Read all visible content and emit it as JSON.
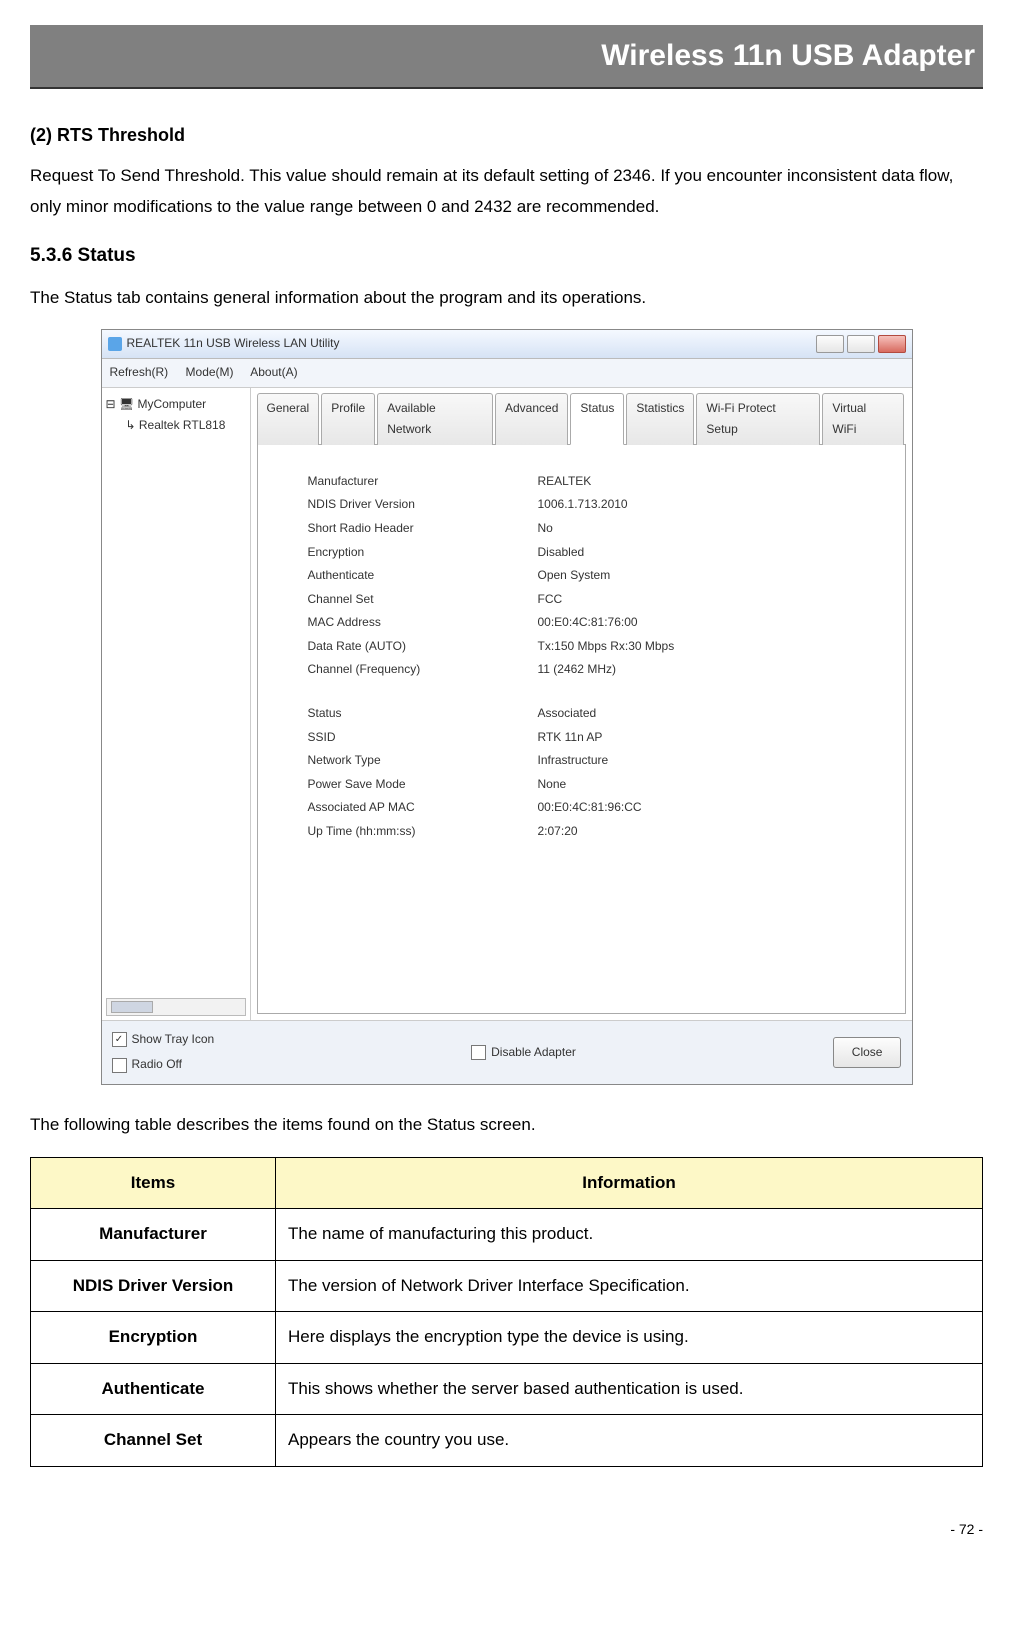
{
  "header": {
    "title": "Wireless 11n USB Adapter"
  },
  "sec_rts": {
    "heading": "(2) RTS Threshold",
    "para": "Request To Send Threshold. This value should remain at its default setting of 2346. If you encounter inconsistent data flow, only minor modifications to the value range between 0 and 2432 are recommended."
  },
  "sec_status": {
    "heading": "5.3.6    Status",
    "para": "The Status tab contains general information about the program and its operations.",
    "table_intro": "The following table describes the items found on the Status screen."
  },
  "win": {
    "title": "REALTEK 11n USB Wireless LAN Utility",
    "menu": [
      "Refresh(R)",
      "Mode(M)",
      "About(A)"
    ],
    "tree": {
      "root": "MyComputer",
      "child": "Realtek RTL818"
    },
    "tabs": [
      "General",
      "Profile",
      "Available Network",
      "Advanced",
      "Status",
      "Statistics",
      "Wi-Fi Protect Setup",
      "Virtual WiFi"
    ],
    "active_tab": "Status",
    "group1": [
      {
        "k": "Manufacturer",
        "v": "REALTEK"
      },
      {
        "k": "NDIS Driver Version",
        "v": "1006.1.713.2010"
      },
      {
        "k": "Short Radio Header",
        "v": "No"
      },
      {
        "k": "Encryption",
        "v": "Disabled"
      },
      {
        "k": "Authenticate",
        "v": "Open System"
      },
      {
        "k": "Channel Set",
        "v": "FCC"
      },
      {
        "k": "MAC Address",
        "v": "00:E0:4C:81:76:00"
      },
      {
        "k": "Data Rate (AUTO)",
        "v": "Tx:150 Mbps Rx:30 Mbps"
      },
      {
        "k": "Channel (Frequency)",
        "v": "11 (2462 MHz)"
      }
    ],
    "group2": [
      {
        "k": "Status",
        "v": "Associated"
      },
      {
        "k": "SSID",
        "v": "RTK 11n AP"
      },
      {
        "k": "Network Type",
        "v": "Infrastructure"
      },
      {
        "k": "Power Save Mode",
        "v": "None"
      },
      {
        "k": "Associated AP MAC",
        "v": "00:E0:4C:81:96:CC"
      },
      {
        "k": "Up Time (hh:mm:ss)",
        "v": "2:07:20"
      }
    ],
    "footer": {
      "show_tray": "Show Tray Icon",
      "radio_off": "Radio Off",
      "disable_adapter": "Disable Adapter",
      "close": "Close"
    }
  },
  "table": {
    "head_items": "Items",
    "head_info": "Information",
    "rows": [
      {
        "item": "Manufacturer",
        "info": "The name of manufacturing this product."
      },
      {
        "item": "NDIS Driver Version",
        "info": "The version of Network Driver Interface Specification."
      },
      {
        "item": "Encryption",
        "info": "Here displays the encryption type the device is using."
      },
      {
        "item": "Authenticate",
        "info": "This shows whether the server based authentication is used."
      },
      {
        "item": "Channel Set",
        "info": "Appears the country you use."
      }
    ]
  },
  "page_num": "- 72 -"
}
